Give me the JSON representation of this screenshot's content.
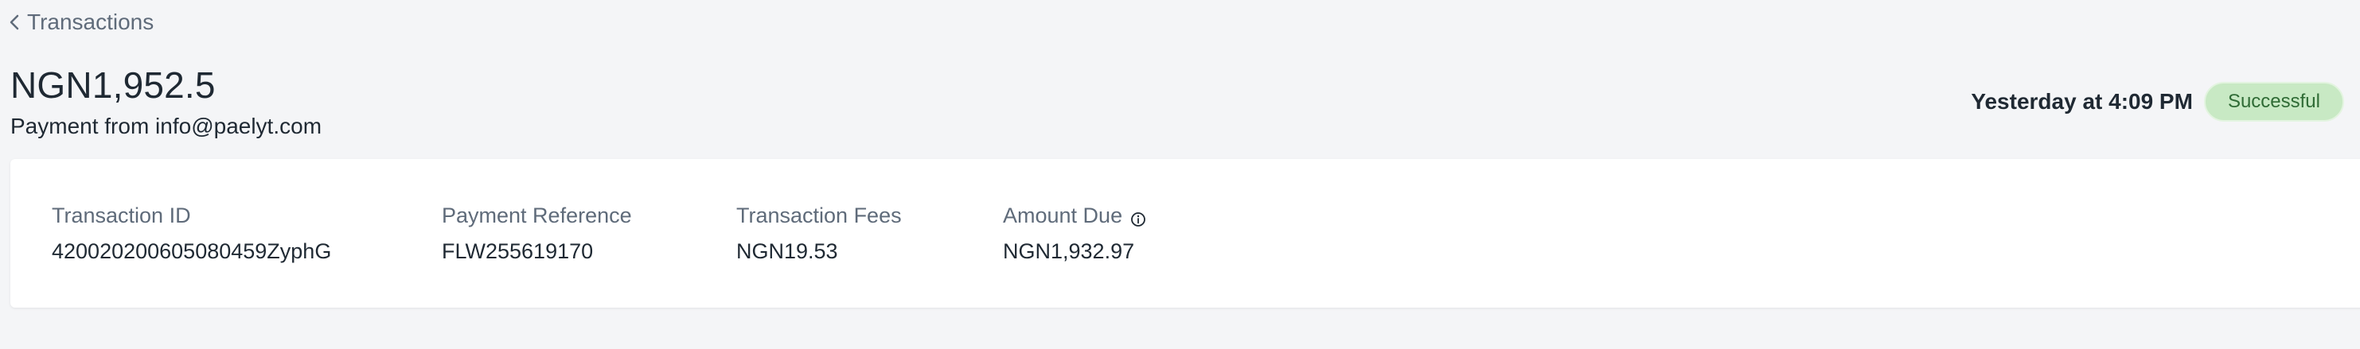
{
  "header": {
    "back_label": "Transactions",
    "amount": "NGN1,952.5",
    "subtitle": "Payment from info@paelyt.com",
    "timestamp": "Yesterday at 4:09 PM",
    "status": "Successful"
  },
  "details": {
    "transaction_id": {
      "label": "Transaction ID",
      "value": "420020200605080459ZyphG"
    },
    "payment_reference": {
      "label": "Payment Reference",
      "value": "FLW255619170"
    },
    "transaction_fees": {
      "label": "Transaction Fees",
      "value": "NGN19.53"
    },
    "amount_due": {
      "label": "Amount Due",
      "value": "NGN1,932.97"
    }
  },
  "colors": {
    "background": "#f4f5f7",
    "status_badge_bg": "#c8e9c4",
    "status_badge_text": "#2f6b35"
  },
  "icons": {
    "back": "chevron-left-icon",
    "amount_due_info": "info-icon"
  }
}
